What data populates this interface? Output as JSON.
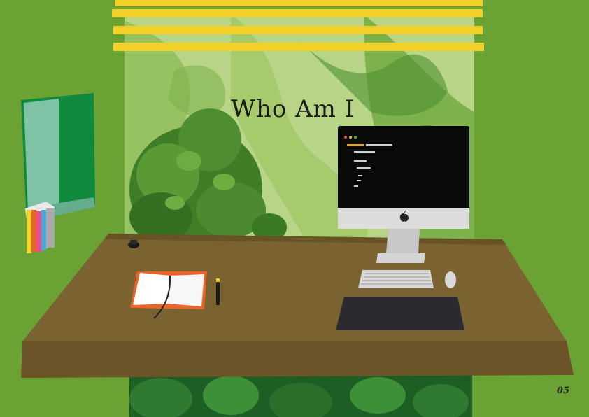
{
  "scene": {
    "title": "Who Am I",
    "page_number": "05"
  },
  "colors": {
    "wall": "#6aa334",
    "blinds": "#f2d02a",
    "desk": "#7a6330",
    "desk_edge": "#6a5428",
    "monitor_screen": "#0a0a0a",
    "monitor_body": "#dcdcdc",
    "mousepad": "#2b2b2f",
    "notebook_cover": "#e8642a"
  },
  "icons": [
    "apple-logo-icon",
    "window-icon",
    "books-icon",
    "notebook-icon",
    "pencil-icon",
    "keyboard-icon",
    "mouse-icon"
  ]
}
